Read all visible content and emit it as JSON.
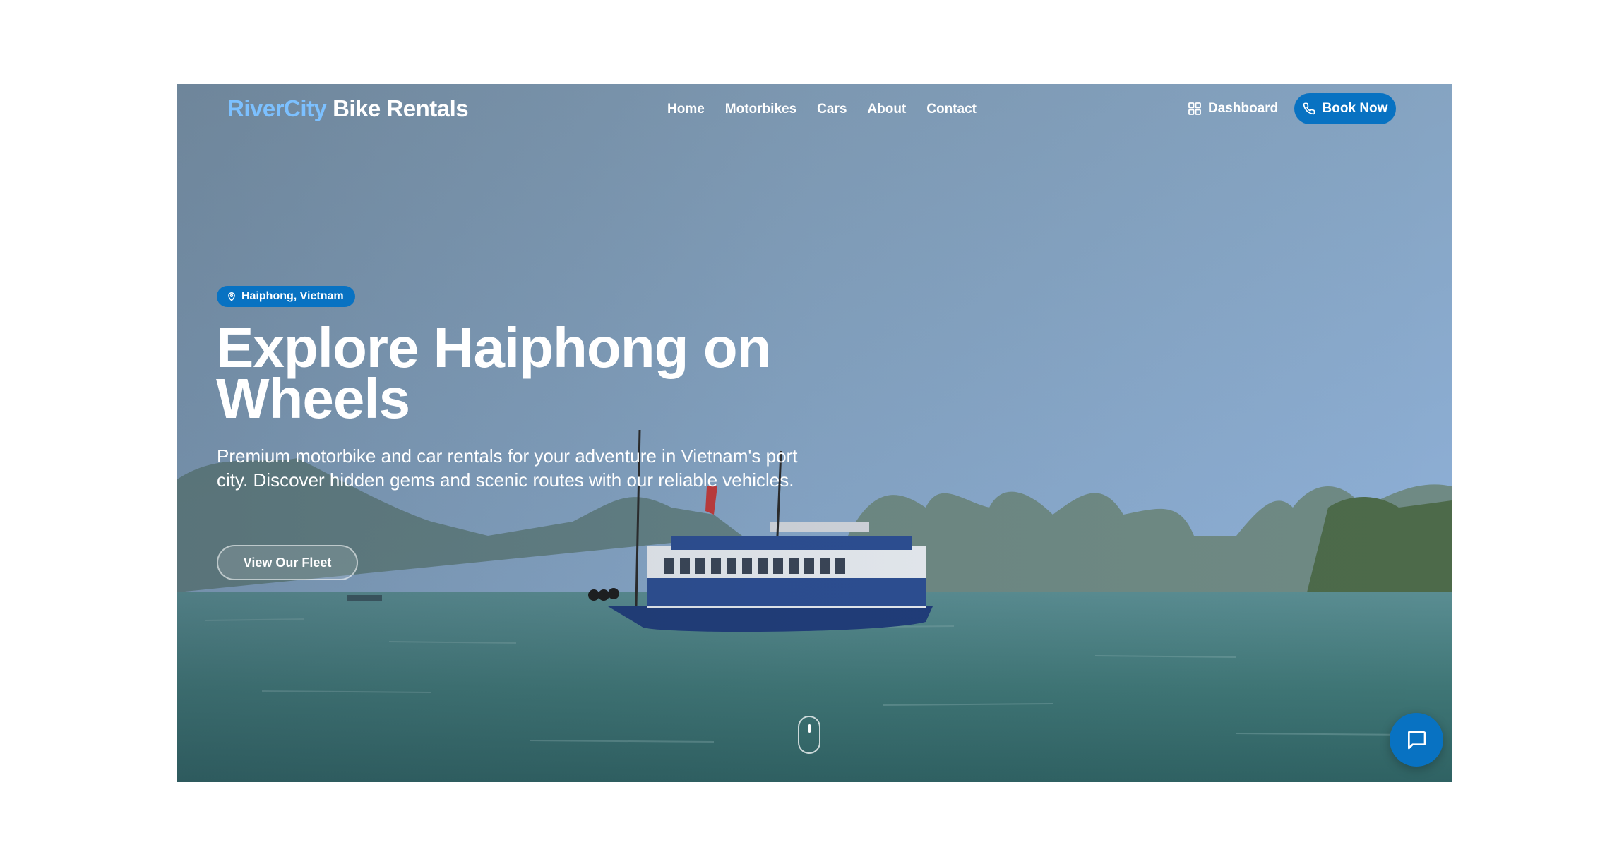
{
  "brand": {
    "part1": "RiverCity",
    "part2": "Bike Rentals"
  },
  "nav": {
    "items": [
      "Home",
      "Motorbikes",
      "Cars",
      "About",
      "Contact"
    ],
    "dashboard_label": "Dashboard",
    "book_label": "Book Now"
  },
  "hero": {
    "location_badge": "Haiphong, Vietnam",
    "title_line1": "Explore Haiphong on",
    "title_line2": "Wheels",
    "description": "Premium motorbike and car rentals for your adventure in Vietnam's port city. Discover hidden gems and scenic routes with our reliable vehicles.",
    "cta_label": "View Our Fleet"
  },
  "icons": {
    "dashboard": "grid-icon",
    "book": "phone-icon",
    "badge": "map-pin-icon",
    "scroll": "mouse-scroll-icon",
    "chat": "chat-icon"
  },
  "colors": {
    "accent": "#0872c2",
    "brand_light": "#7cc0ff"
  }
}
